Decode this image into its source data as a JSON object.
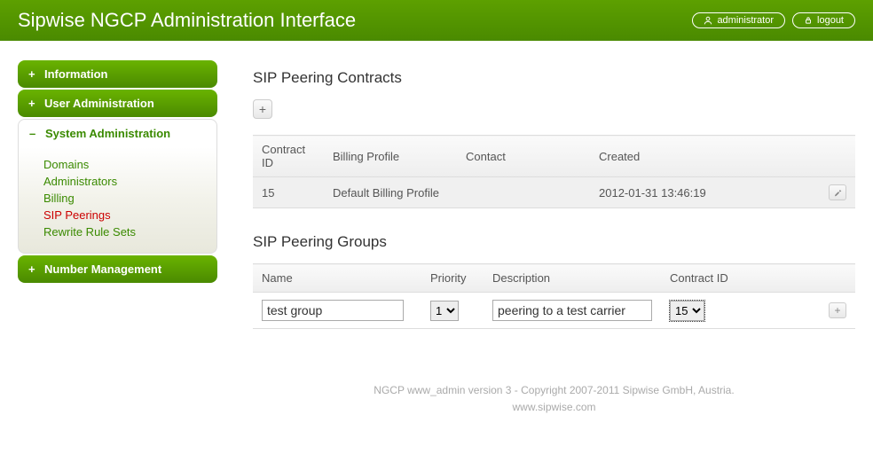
{
  "header": {
    "title": "Sipwise NGCP Administration Interface",
    "user_label": "administrator",
    "logout_label": "logout"
  },
  "sidebar": {
    "information": "Information",
    "user_admin": "User Administration",
    "sys_admin": "System Administration",
    "number_mgmt": "Number Management",
    "links": {
      "domains": "Domains",
      "administrators": "Administrators",
      "billing": "Billing",
      "sip_peerings": "SIP Peerings",
      "rewrite": "Rewrite Rule Sets"
    }
  },
  "contracts": {
    "title": "SIP Peering Contracts",
    "headers": {
      "id": "Contract ID",
      "profile": "Billing Profile",
      "contact": "Contact",
      "created": "Created"
    },
    "row": {
      "id": "15",
      "profile": "Default Billing Profile",
      "contact": "",
      "created": "2012-01-31 13:46:19"
    }
  },
  "groups": {
    "title": "SIP Peering Groups",
    "headers": {
      "name": "Name",
      "priority": "Priority",
      "description": "Description",
      "contract": "Contract ID"
    },
    "row": {
      "name": "test group",
      "priority": "1",
      "description": "peering to a test carrier",
      "contract": "15"
    }
  },
  "footer": {
    "line1": "NGCP www_admin version 3 - Copyright 2007-2011 Sipwise GmbH, Austria.",
    "line2": "www.sipwise.com"
  }
}
